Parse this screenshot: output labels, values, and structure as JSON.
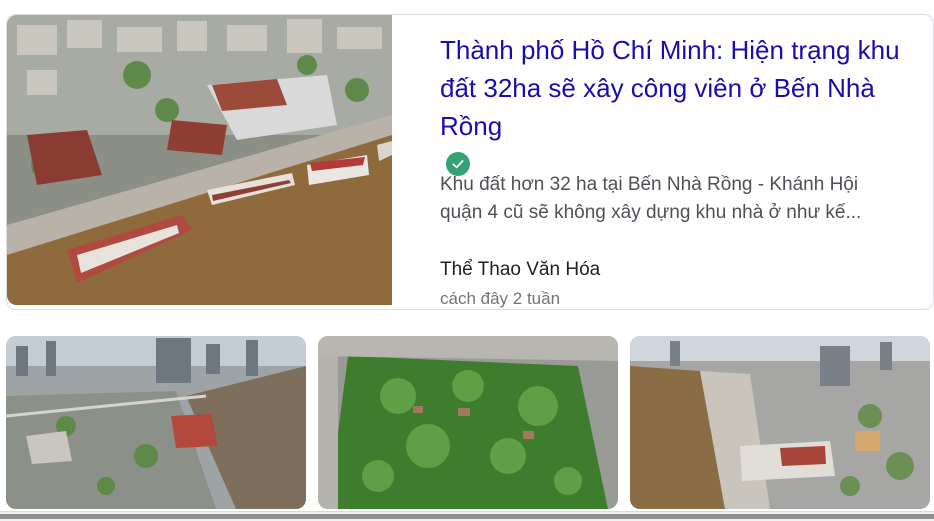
{
  "result": {
    "headline": "Thành phố Hồ Chí Minh: Hiện trạng khu đất 32ha sẽ xây công viên ở Bến Nhà Rồng",
    "snippet_line1": "Khu đất hơn 32 ha tại Bến Nhà Rồng - Khánh Hội",
    "snippet_line2": "quận 4 cũ sẽ không xây dựng khu nhà ở như kế...",
    "source": "Thể Thao Văn Hóa",
    "time": "cách đây 2 tuần",
    "verified_icon": "check-circle-icon"
  },
  "colors": {
    "link": "#1a0dab",
    "verified": "#34a176",
    "snippet": "#4d5156",
    "meta": "#70757a"
  }
}
